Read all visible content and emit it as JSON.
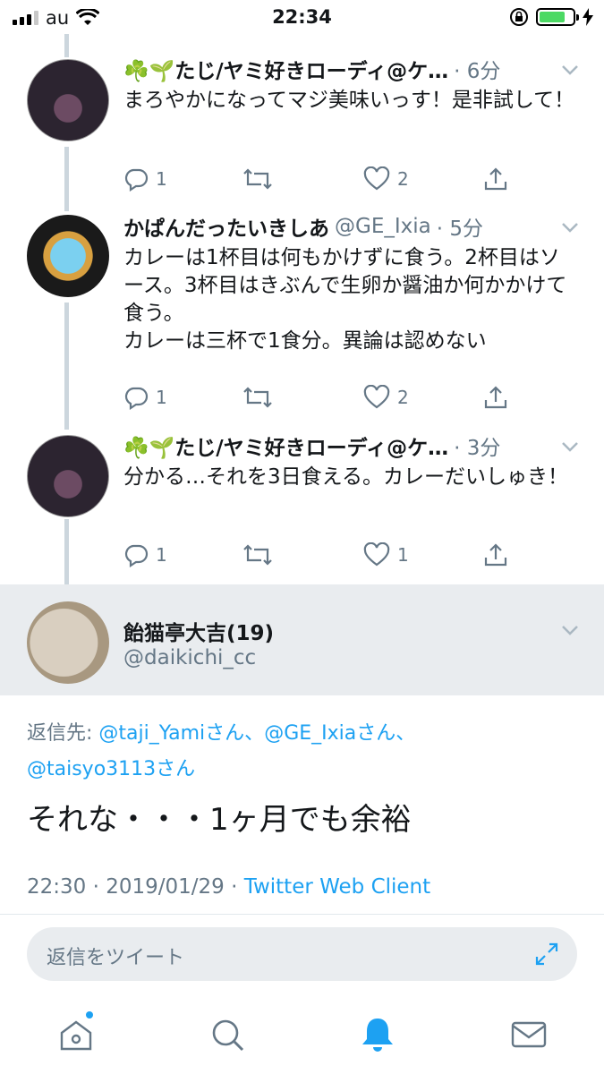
{
  "status_bar": {
    "carrier": "au",
    "time": "22:34"
  },
  "tweets": [
    {
      "name": "☘️🌱たじ/ヤミ好きローディ@ケ…",
      "time": "· 6分",
      "text": "まろやかになってマジ美味いっす！是非試して！",
      "replies": "1",
      "likes": "2"
    },
    {
      "name": "かぱんだったいきしあ",
      "handle": "@GE_Ixia",
      "time": "· 5分",
      "text": "カレーは1杯目は何もかけずに食う。2杯目はソース。3杯目はきぶんで生卵か醤油か何かかけて食う。\nカレーは三杯で1食分。異論は認めない",
      "replies": "1",
      "likes": "2"
    },
    {
      "name": "☘️🌱たじ/ヤミ好きローディ@ケ…",
      "time": "· 3分",
      "text": "分かる…それを3日食える。カレーだいしゅき！",
      "replies": "1",
      "likes": "1"
    }
  ],
  "main_tweet": {
    "name": "飴猫亭大吉(19)",
    "handle": "@daikichi_cc",
    "reply_prefix": "返信先: ",
    "reply_to_1": "@taji_Yamiさん、",
    "reply_to_2": "@GE_Ixiaさん、",
    "reply_to_3": "@taisyo3113さん",
    "text": "それな・・・1ヶ月でも余裕",
    "timestamp": "22:30 · 2019/01/29 · ",
    "client": "Twitter Web Client"
  },
  "reply_box": {
    "placeholder": "返信をツイート"
  },
  "tabs": [
    "home",
    "search",
    "notifications",
    "messages"
  ],
  "colors": {
    "accent": "#1da1f2",
    "gray": "#657786",
    "thread_line": "#ccd6dd"
  }
}
